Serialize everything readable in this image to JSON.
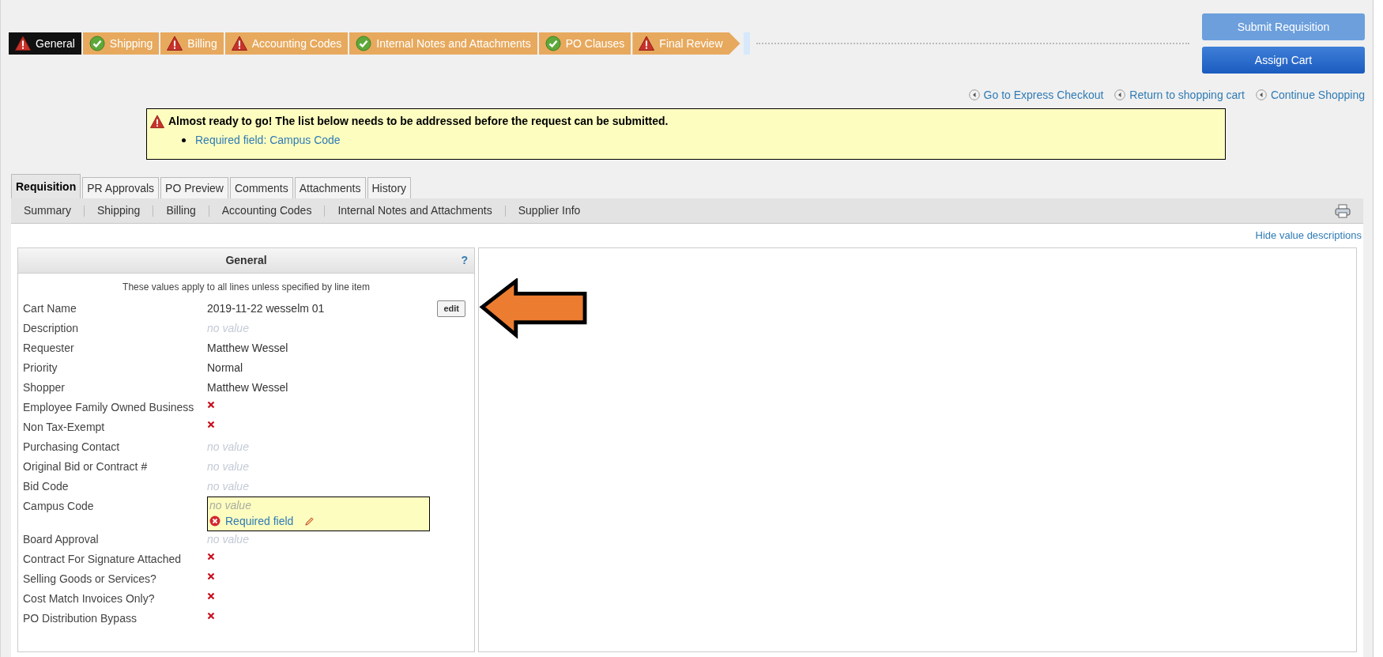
{
  "steps": [
    {
      "label": "General",
      "complete": false,
      "selected": true
    },
    {
      "label": "Shipping",
      "complete": true,
      "selected": false
    },
    {
      "label": "Billing",
      "complete": false,
      "selected": false
    },
    {
      "label": "Accounting Codes",
      "complete": false,
      "selected": false
    },
    {
      "label": "Internal Notes and Attachments",
      "complete": true,
      "selected": false
    },
    {
      "label": "PO Clauses",
      "complete": true,
      "selected": false
    },
    {
      "label": "Final Review",
      "complete": false,
      "selected": false
    }
  ],
  "actions": [
    {
      "label": "Submit Requisition",
      "disabled": true
    },
    {
      "label": "Assign Cart",
      "disabled": false
    }
  ],
  "links": [
    "Go to Express Checkout",
    "Return to shopping cart",
    "Continue Shopping"
  ],
  "alert": {
    "message": "Almost ready to go! The list below needs to be addressed before the request can be submitted.",
    "items": [
      "Required field: Campus Code"
    ]
  },
  "tabs": [
    {
      "label": "Requisition",
      "selected": true
    },
    {
      "label": "PR Approvals",
      "selected": false
    },
    {
      "label": "PO Preview",
      "selected": false
    },
    {
      "label": "Comments",
      "selected": false
    },
    {
      "label": "Attachments",
      "selected": false
    },
    {
      "label": "History",
      "selected": false
    }
  ],
  "subnav": [
    "Summary",
    "Shipping",
    "Billing",
    "Accounting Codes",
    "Internal Notes and Attachments",
    "Supplier Info"
  ],
  "hide_link": "Hide value descriptions",
  "panel": {
    "title": "General",
    "help": "?",
    "note": "These values apply to all lines unless specified by line item",
    "edit_button": "edit",
    "fields": [
      {
        "label": "Cart Name",
        "kind": "text",
        "value": "2019-11-22 wesselm 01"
      },
      {
        "label": "Description",
        "kind": "empty",
        "value": "no value"
      },
      {
        "label": "Requester",
        "kind": "text",
        "value": "Matthew Wessel"
      },
      {
        "label": "Priority",
        "kind": "text",
        "value": "Normal"
      },
      {
        "label": "Shopper",
        "kind": "text",
        "value": "Matthew Wessel"
      },
      {
        "label": "Employee Family Owned Business",
        "kind": "cross"
      },
      {
        "label": "Non Tax-Exempt",
        "kind": "cross"
      },
      {
        "label": "Purchasing Contact",
        "kind": "empty",
        "value": "no value"
      },
      {
        "label": "Original Bid or Contract #",
        "kind": "empty",
        "value": "no value"
      },
      {
        "label": "Bid Code",
        "kind": "empty",
        "value": "no value"
      },
      {
        "label": "Campus Code",
        "kind": "required",
        "value": "no value",
        "error": "Required field"
      },
      {
        "label": "Board Approval",
        "kind": "empty",
        "value": "no value"
      },
      {
        "label": "Contract For Signature Attached",
        "kind": "cross"
      },
      {
        "label": "Selling Goods or Services?",
        "kind": "cross"
      },
      {
        "label": "Cost Match Invoices Only?",
        "kind": "cross"
      },
      {
        "label": "PO Distribution Bypass",
        "kind": "cross"
      }
    ]
  }
}
